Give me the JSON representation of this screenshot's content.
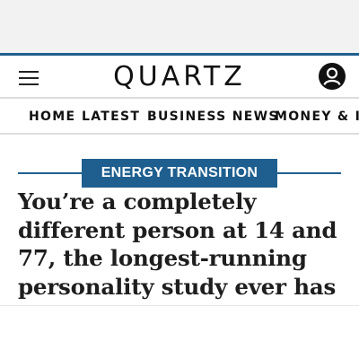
{
  "header": {
    "logo_text": "QUARTZ",
    "menu_icon": "hamburger-menu-icon",
    "profile_icon": "user-account-icon",
    "accent_color": "#1f5f8f"
  },
  "nav": {
    "items": [
      {
        "label": "HOME"
      },
      {
        "label": "LATEST"
      },
      {
        "label": "BUSINESS NEWS"
      },
      {
        "label": "MONEY & I"
      }
    ]
  },
  "article": {
    "kicker": "ENERGY TRANSITION",
    "headline": "You’re a completely different person at 14 and 77, the longest-running personality study ever has"
  }
}
